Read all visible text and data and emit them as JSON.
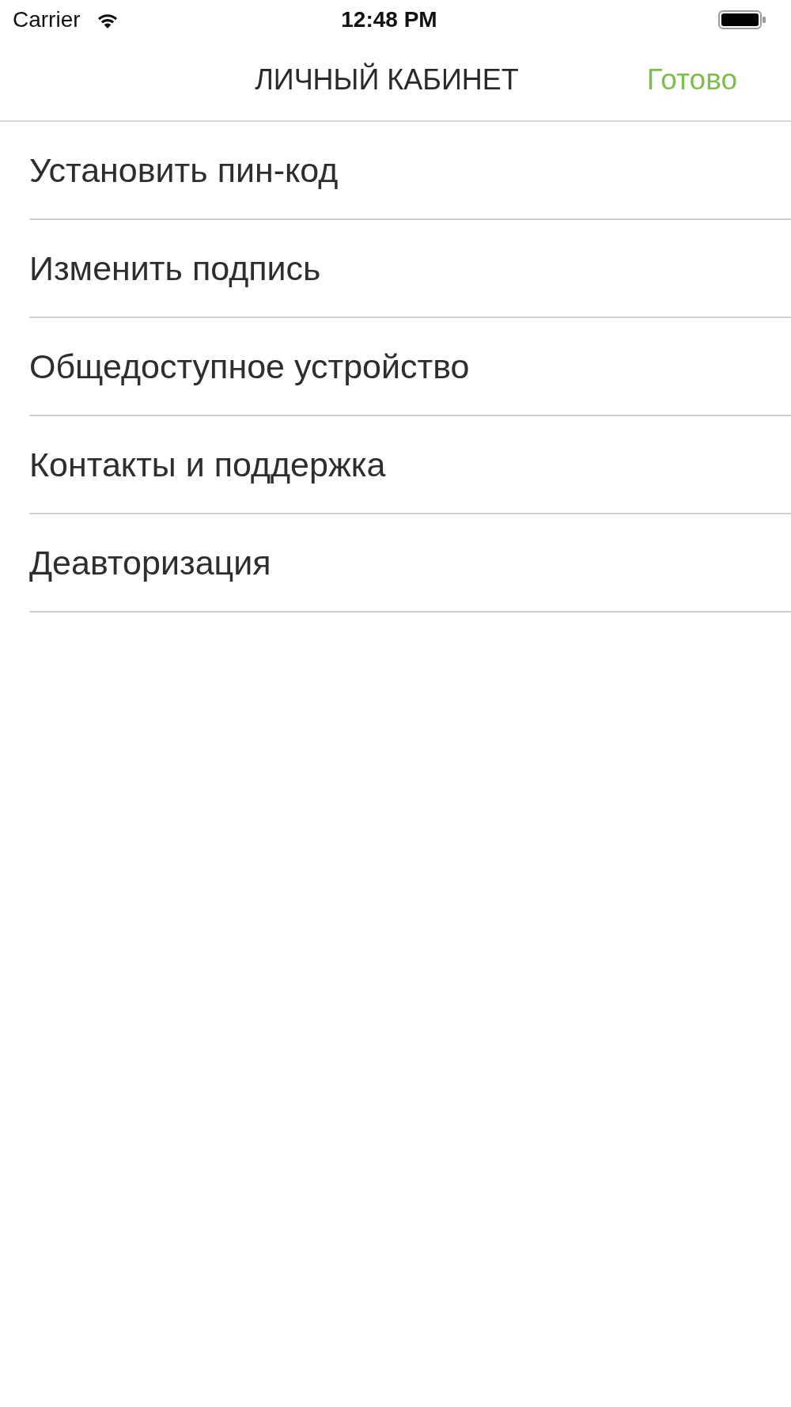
{
  "status_bar": {
    "carrier": "Carrier",
    "time": "12:48 PM"
  },
  "nav_bar": {
    "title": "ЛИЧНЫЙ КАБИНЕТ",
    "done_button": "Готово"
  },
  "menu_items": [
    {
      "label": "Установить пин-код"
    },
    {
      "label": "Изменить подпись"
    },
    {
      "label": "Общедоступное устройство"
    },
    {
      "label": "Контакты и поддержка"
    },
    {
      "label": "Деавторизация"
    }
  ]
}
